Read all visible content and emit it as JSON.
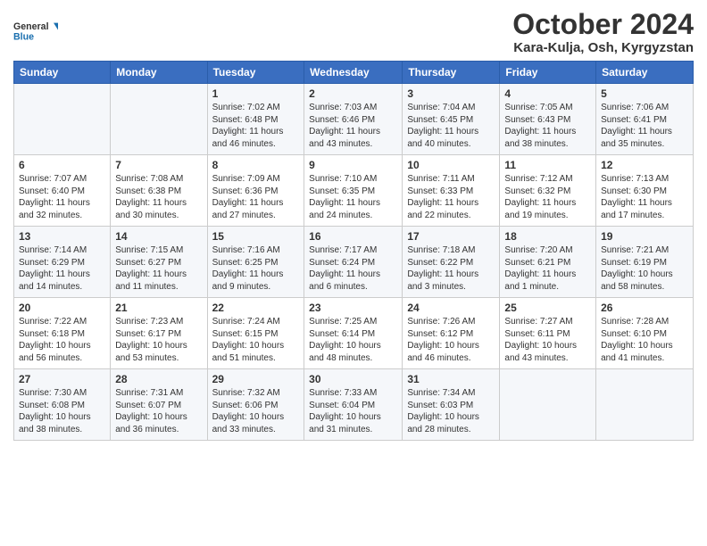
{
  "logo": {
    "line1": "General",
    "line2": "Blue"
  },
  "title": "October 2024",
  "location": "Kara-Kulja, Osh, Kyrgyzstan",
  "days_of_week": [
    "Sunday",
    "Monday",
    "Tuesday",
    "Wednesday",
    "Thursday",
    "Friday",
    "Saturday"
  ],
  "weeks": [
    [
      {
        "day": "",
        "info": ""
      },
      {
        "day": "",
        "info": ""
      },
      {
        "day": "1",
        "info": "Sunrise: 7:02 AM\nSunset: 6:48 PM\nDaylight: 11 hours and 46 minutes."
      },
      {
        "day": "2",
        "info": "Sunrise: 7:03 AM\nSunset: 6:46 PM\nDaylight: 11 hours and 43 minutes."
      },
      {
        "day": "3",
        "info": "Sunrise: 7:04 AM\nSunset: 6:45 PM\nDaylight: 11 hours and 40 minutes."
      },
      {
        "day": "4",
        "info": "Sunrise: 7:05 AM\nSunset: 6:43 PM\nDaylight: 11 hours and 38 minutes."
      },
      {
        "day": "5",
        "info": "Sunrise: 7:06 AM\nSunset: 6:41 PM\nDaylight: 11 hours and 35 minutes."
      }
    ],
    [
      {
        "day": "6",
        "info": "Sunrise: 7:07 AM\nSunset: 6:40 PM\nDaylight: 11 hours and 32 minutes."
      },
      {
        "day": "7",
        "info": "Sunrise: 7:08 AM\nSunset: 6:38 PM\nDaylight: 11 hours and 30 minutes."
      },
      {
        "day": "8",
        "info": "Sunrise: 7:09 AM\nSunset: 6:36 PM\nDaylight: 11 hours and 27 minutes."
      },
      {
        "day": "9",
        "info": "Sunrise: 7:10 AM\nSunset: 6:35 PM\nDaylight: 11 hours and 24 minutes."
      },
      {
        "day": "10",
        "info": "Sunrise: 7:11 AM\nSunset: 6:33 PM\nDaylight: 11 hours and 22 minutes."
      },
      {
        "day": "11",
        "info": "Sunrise: 7:12 AM\nSunset: 6:32 PM\nDaylight: 11 hours and 19 minutes."
      },
      {
        "day": "12",
        "info": "Sunrise: 7:13 AM\nSunset: 6:30 PM\nDaylight: 11 hours and 17 minutes."
      }
    ],
    [
      {
        "day": "13",
        "info": "Sunrise: 7:14 AM\nSunset: 6:29 PM\nDaylight: 11 hours and 14 minutes."
      },
      {
        "day": "14",
        "info": "Sunrise: 7:15 AM\nSunset: 6:27 PM\nDaylight: 11 hours and 11 minutes."
      },
      {
        "day": "15",
        "info": "Sunrise: 7:16 AM\nSunset: 6:25 PM\nDaylight: 11 hours and 9 minutes."
      },
      {
        "day": "16",
        "info": "Sunrise: 7:17 AM\nSunset: 6:24 PM\nDaylight: 11 hours and 6 minutes."
      },
      {
        "day": "17",
        "info": "Sunrise: 7:18 AM\nSunset: 6:22 PM\nDaylight: 11 hours and 3 minutes."
      },
      {
        "day": "18",
        "info": "Sunrise: 7:20 AM\nSunset: 6:21 PM\nDaylight: 11 hours and 1 minute."
      },
      {
        "day": "19",
        "info": "Sunrise: 7:21 AM\nSunset: 6:19 PM\nDaylight: 10 hours and 58 minutes."
      }
    ],
    [
      {
        "day": "20",
        "info": "Sunrise: 7:22 AM\nSunset: 6:18 PM\nDaylight: 10 hours and 56 minutes."
      },
      {
        "day": "21",
        "info": "Sunrise: 7:23 AM\nSunset: 6:17 PM\nDaylight: 10 hours and 53 minutes."
      },
      {
        "day": "22",
        "info": "Sunrise: 7:24 AM\nSunset: 6:15 PM\nDaylight: 10 hours and 51 minutes."
      },
      {
        "day": "23",
        "info": "Sunrise: 7:25 AM\nSunset: 6:14 PM\nDaylight: 10 hours and 48 minutes."
      },
      {
        "day": "24",
        "info": "Sunrise: 7:26 AM\nSunset: 6:12 PM\nDaylight: 10 hours and 46 minutes."
      },
      {
        "day": "25",
        "info": "Sunrise: 7:27 AM\nSunset: 6:11 PM\nDaylight: 10 hours and 43 minutes."
      },
      {
        "day": "26",
        "info": "Sunrise: 7:28 AM\nSunset: 6:10 PM\nDaylight: 10 hours and 41 minutes."
      }
    ],
    [
      {
        "day": "27",
        "info": "Sunrise: 7:30 AM\nSunset: 6:08 PM\nDaylight: 10 hours and 38 minutes."
      },
      {
        "day": "28",
        "info": "Sunrise: 7:31 AM\nSunset: 6:07 PM\nDaylight: 10 hours and 36 minutes."
      },
      {
        "day": "29",
        "info": "Sunrise: 7:32 AM\nSunset: 6:06 PM\nDaylight: 10 hours and 33 minutes."
      },
      {
        "day": "30",
        "info": "Sunrise: 7:33 AM\nSunset: 6:04 PM\nDaylight: 10 hours and 31 minutes."
      },
      {
        "day": "31",
        "info": "Sunrise: 7:34 AM\nSunset: 6:03 PM\nDaylight: 10 hours and 28 minutes."
      },
      {
        "day": "",
        "info": ""
      },
      {
        "day": "",
        "info": ""
      }
    ]
  ]
}
